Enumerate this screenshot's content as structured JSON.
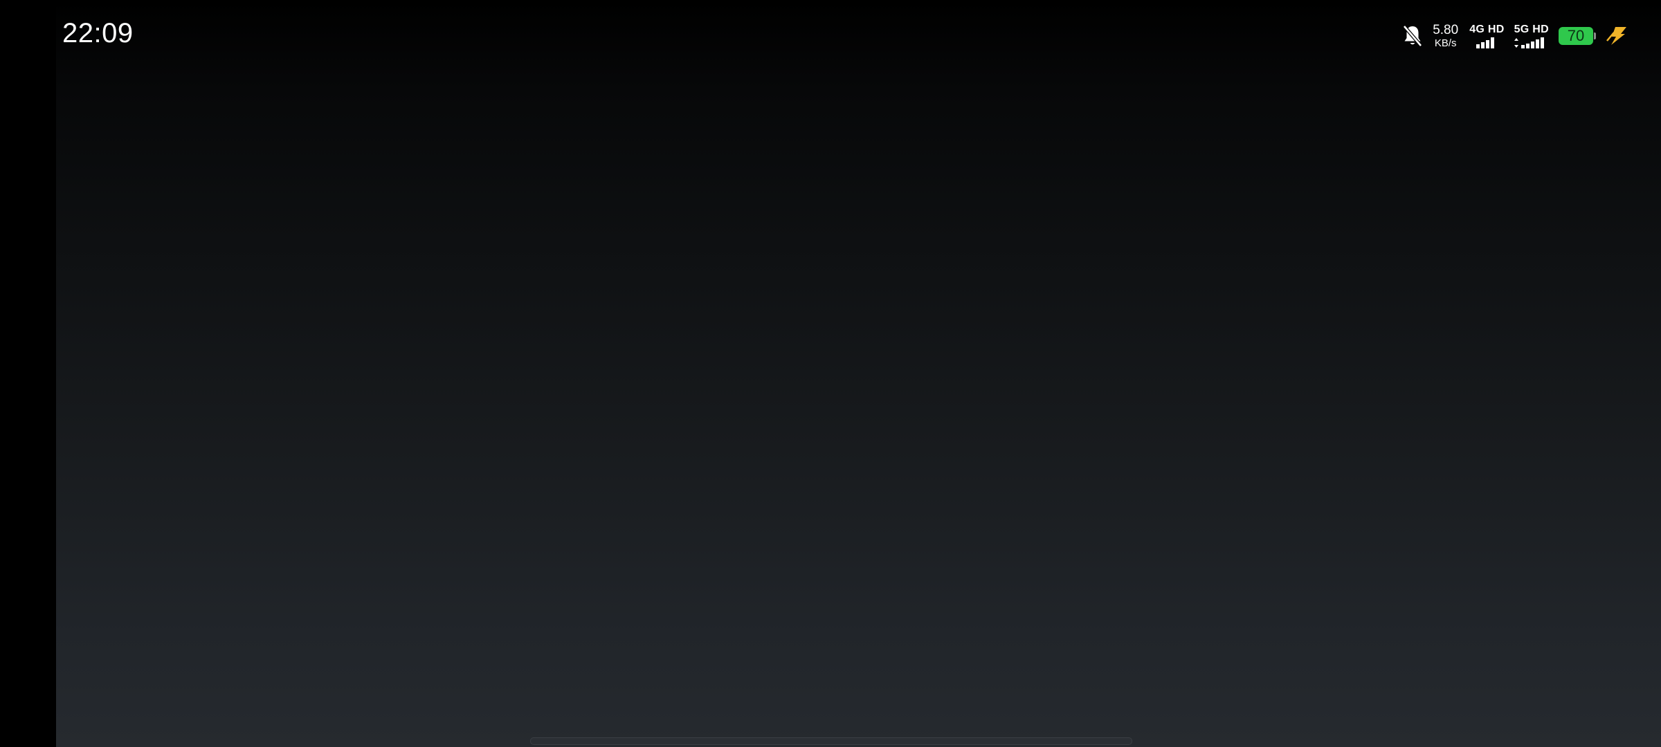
{
  "status_bar": {
    "time": "22:09",
    "network_speed": {
      "value": "5.80",
      "unit": "KB/s"
    },
    "sim1": {
      "label": "4G HD",
      "signal_bars": 4
    },
    "sim2": {
      "label": "5G HD",
      "signal_bars": 5
    },
    "battery": {
      "level": "70",
      "color": "#2fc84c"
    },
    "charging": true,
    "notification_icon": "bell-muted-icon",
    "charge_icon_color": "#f0b429"
  },
  "screen": {
    "background_top": "#000000",
    "background_bottom": "#262a2f"
  }
}
